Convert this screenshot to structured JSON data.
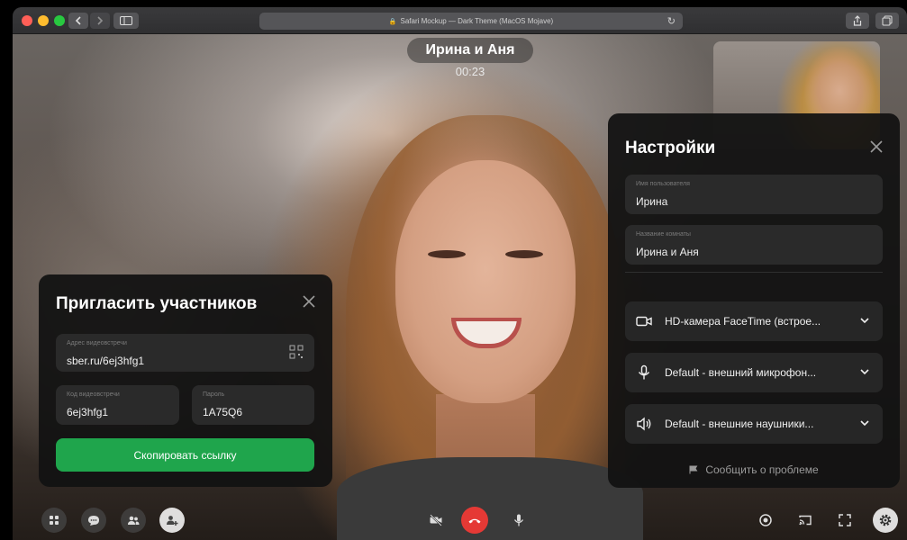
{
  "browser": {
    "url_text": "Safari Mockup — Dark Theme (MacOS Mojave)"
  },
  "call": {
    "title": "Ирина и Аня",
    "timer": "00:23"
  },
  "invite_panel": {
    "title": "Пригласить участников",
    "meeting_address_label": "Адрес видеовстречи",
    "meeting_address_value": "sber.ru/6ej3hfg1",
    "meeting_code_label": "Код видеовстречи",
    "meeting_code_value": "6ej3hfg1",
    "password_label": "Пароль",
    "password_value": "1A75Q6",
    "copy_button": "Скопировать ссылку"
  },
  "settings_panel": {
    "title": "Настройки",
    "username_label": "Имя пользователя",
    "username_value": "Ирина",
    "room_label": "Название комнаты",
    "room_value": "Ирина и Аня",
    "camera": "HD-камера FaceTime (встрое...",
    "microphone": "Default - внешний микрофон...",
    "speakers": "Default - внешние наушники...",
    "report_problem": "Сообщить о проблеме"
  },
  "colors": {
    "accent_green": "#1fa54c",
    "end_call_red": "#e53935",
    "panel_bg": "#121212"
  },
  "icons": {
    "left_controls": [
      "grid-icon",
      "chat-icon",
      "participants-icon",
      "add-participant-icon"
    ],
    "center_controls": [
      "camera-off-icon",
      "end-call-icon",
      "microphone-icon"
    ],
    "right_controls": [
      "record-icon",
      "cast-icon",
      "fullscreen-icon",
      "settings-gear-icon"
    ]
  }
}
